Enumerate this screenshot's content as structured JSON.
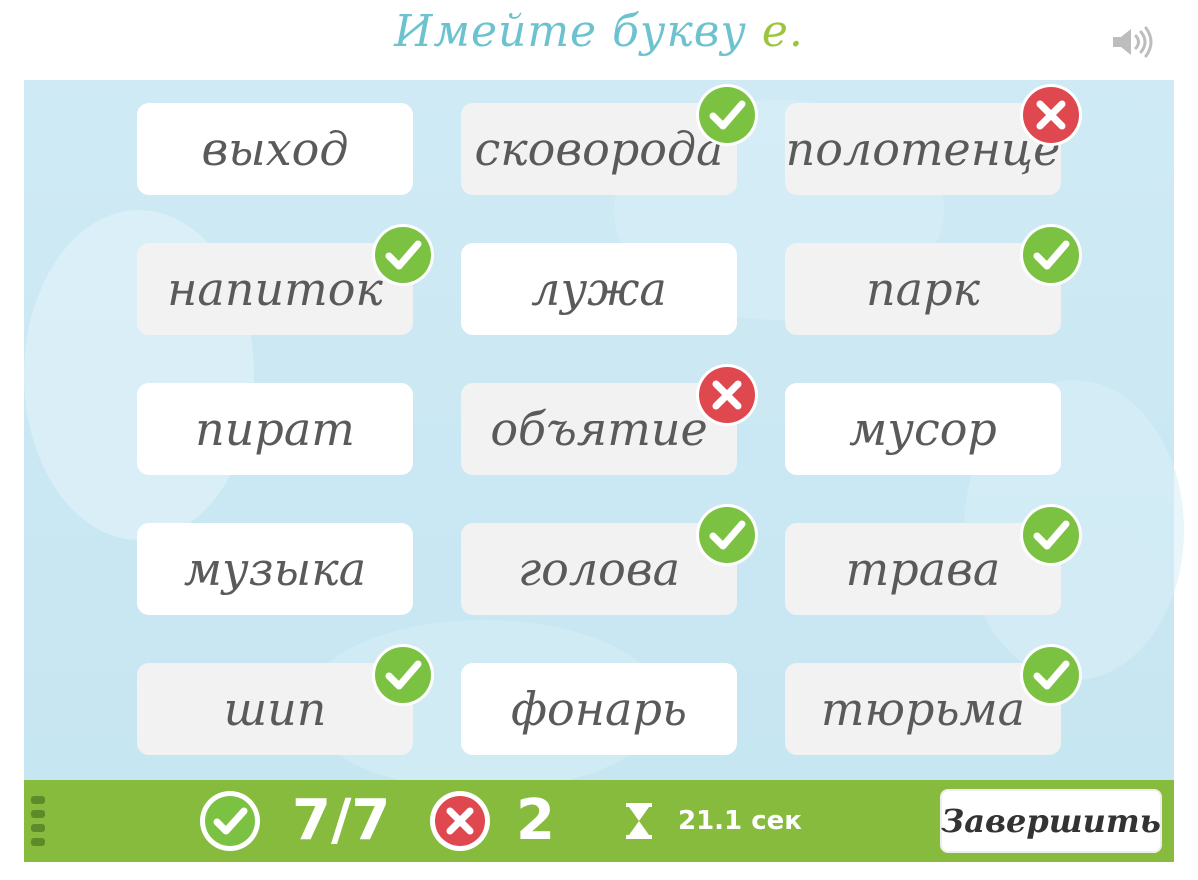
{
  "header": {
    "title_text": "Имейте букву",
    "title_letter": "е.",
    "sound_icon": "speaker-icon"
  },
  "colors": {
    "title": "#6cc3cf",
    "accent_letter": "#9bc53d",
    "correct": "#7cc242",
    "wrong": "#e0484f",
    "footer": "#86bb3d",
    "board": "#cfeaf4"
  },
  "cards": [
    {
      "word": "выход",
      "selected": false,
      "mark": "none"
    },
    {
      "word": "сковорода",
      "selected": true,
      "mark": "correct"
    },
    {
      "word": "полотенце",
      "selected": true,
      "mark": "wrong"
    },
    {
      "word": "напиток",
      "selected": true,
      "mark": "correct"
    },
    {
      "word": "лужа",
      "selected": false,
      "mark": "none"
    },
    {
      "word": "парк",
      "selected": true,
      "mark": "correct"
    },
    {
      "word": "пират",
      "selected": false,
      "mark": "none"
    },
    {
      "word": "объятие",
      "selected": true,
      "mark": "wrong"
    },
    {
      "word": "мусор",
      "selected": false,
      "mark": "none"
    },
    {
      "word": "музыка",
      "selected": false,
      "mark": "none"
    },
    {
      "word": "голова",
      "selected": true,
      "mark": "correct"
    },
    {
      "word": "трава",
      "selected": true,
      "mark": "correct"
    },
    {
      "word": "шип",
      "selected": true,
      "mark": "correct"
    },
    {
      "word": "фонарь",
      "selected": false,
      "mark": "none"
    },
    {
      "word": "тюрьма",
      "selected": true,
      "mark": "correct"
    }
  ],
  "footer": {
    "correct_count": "7/7",
    "wrong_count": "2",
    "timer": "21.1 сек",
    "finish_label": "Завершить",
    "correct_icon": "check-circle-icon",
    "wrong_icon": "x-circle-icon",
    "timer_icon": "hourglass-icon"
  }
}
